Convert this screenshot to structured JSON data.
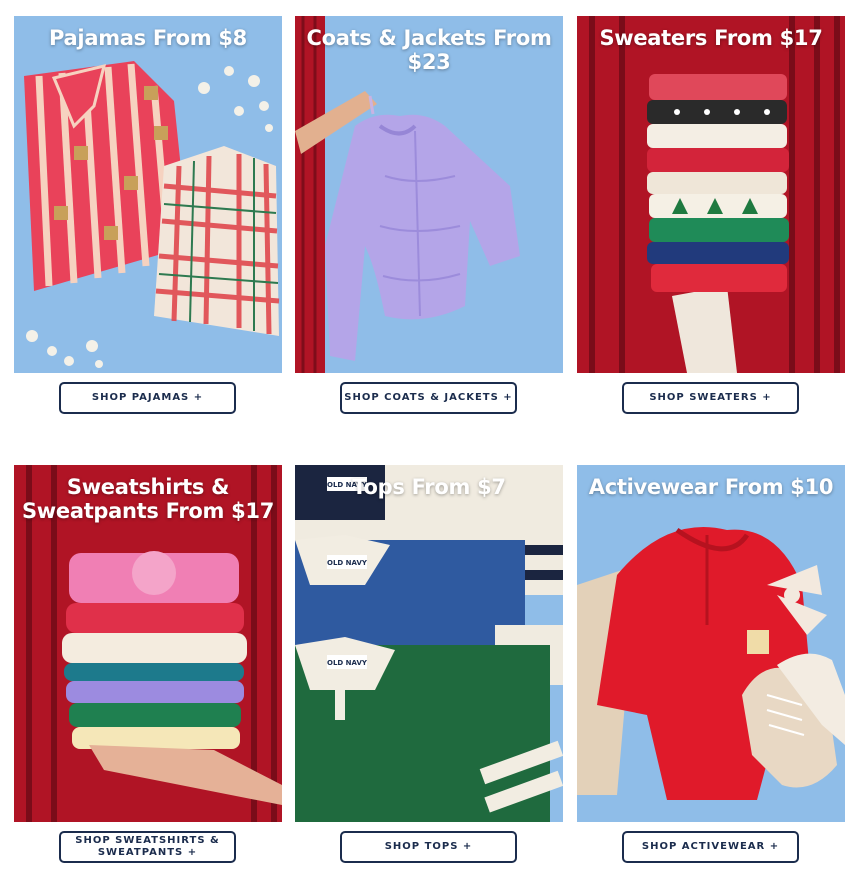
{
  "cards": [
    {
      "title": "Pajamas From $8",
      "button": "SHOP PAJAMAS +"
    },
    {
      "title": "Coats & Jackets From $23",
      "button": "SHOP COATS & JACKETS +"
    },
    {
      "title": "Sweaters From $17",
      "button": "SHOP SWEATERS +"
    },
    {
      "title": "Sweatshirts & Sweatpants From $17",
      "button": "SHOP SWEATSHIRTS & SWEATPANTS +"
    },
    {
      "title": "Tops From $7",
      "button": "SHOP TOPS +"
    },
    {
      "title": "Activewear From $10",
      "button": "SHOP ACTIVEWEAR +"
    }
  ],
  "colors": {
    "sky_blue": "#8fbde8",
    "curtain_red": "#b01425",
    "button_navy": "#1b2c4d"
  },
  "brand_label": "OLD NAVY"
}
